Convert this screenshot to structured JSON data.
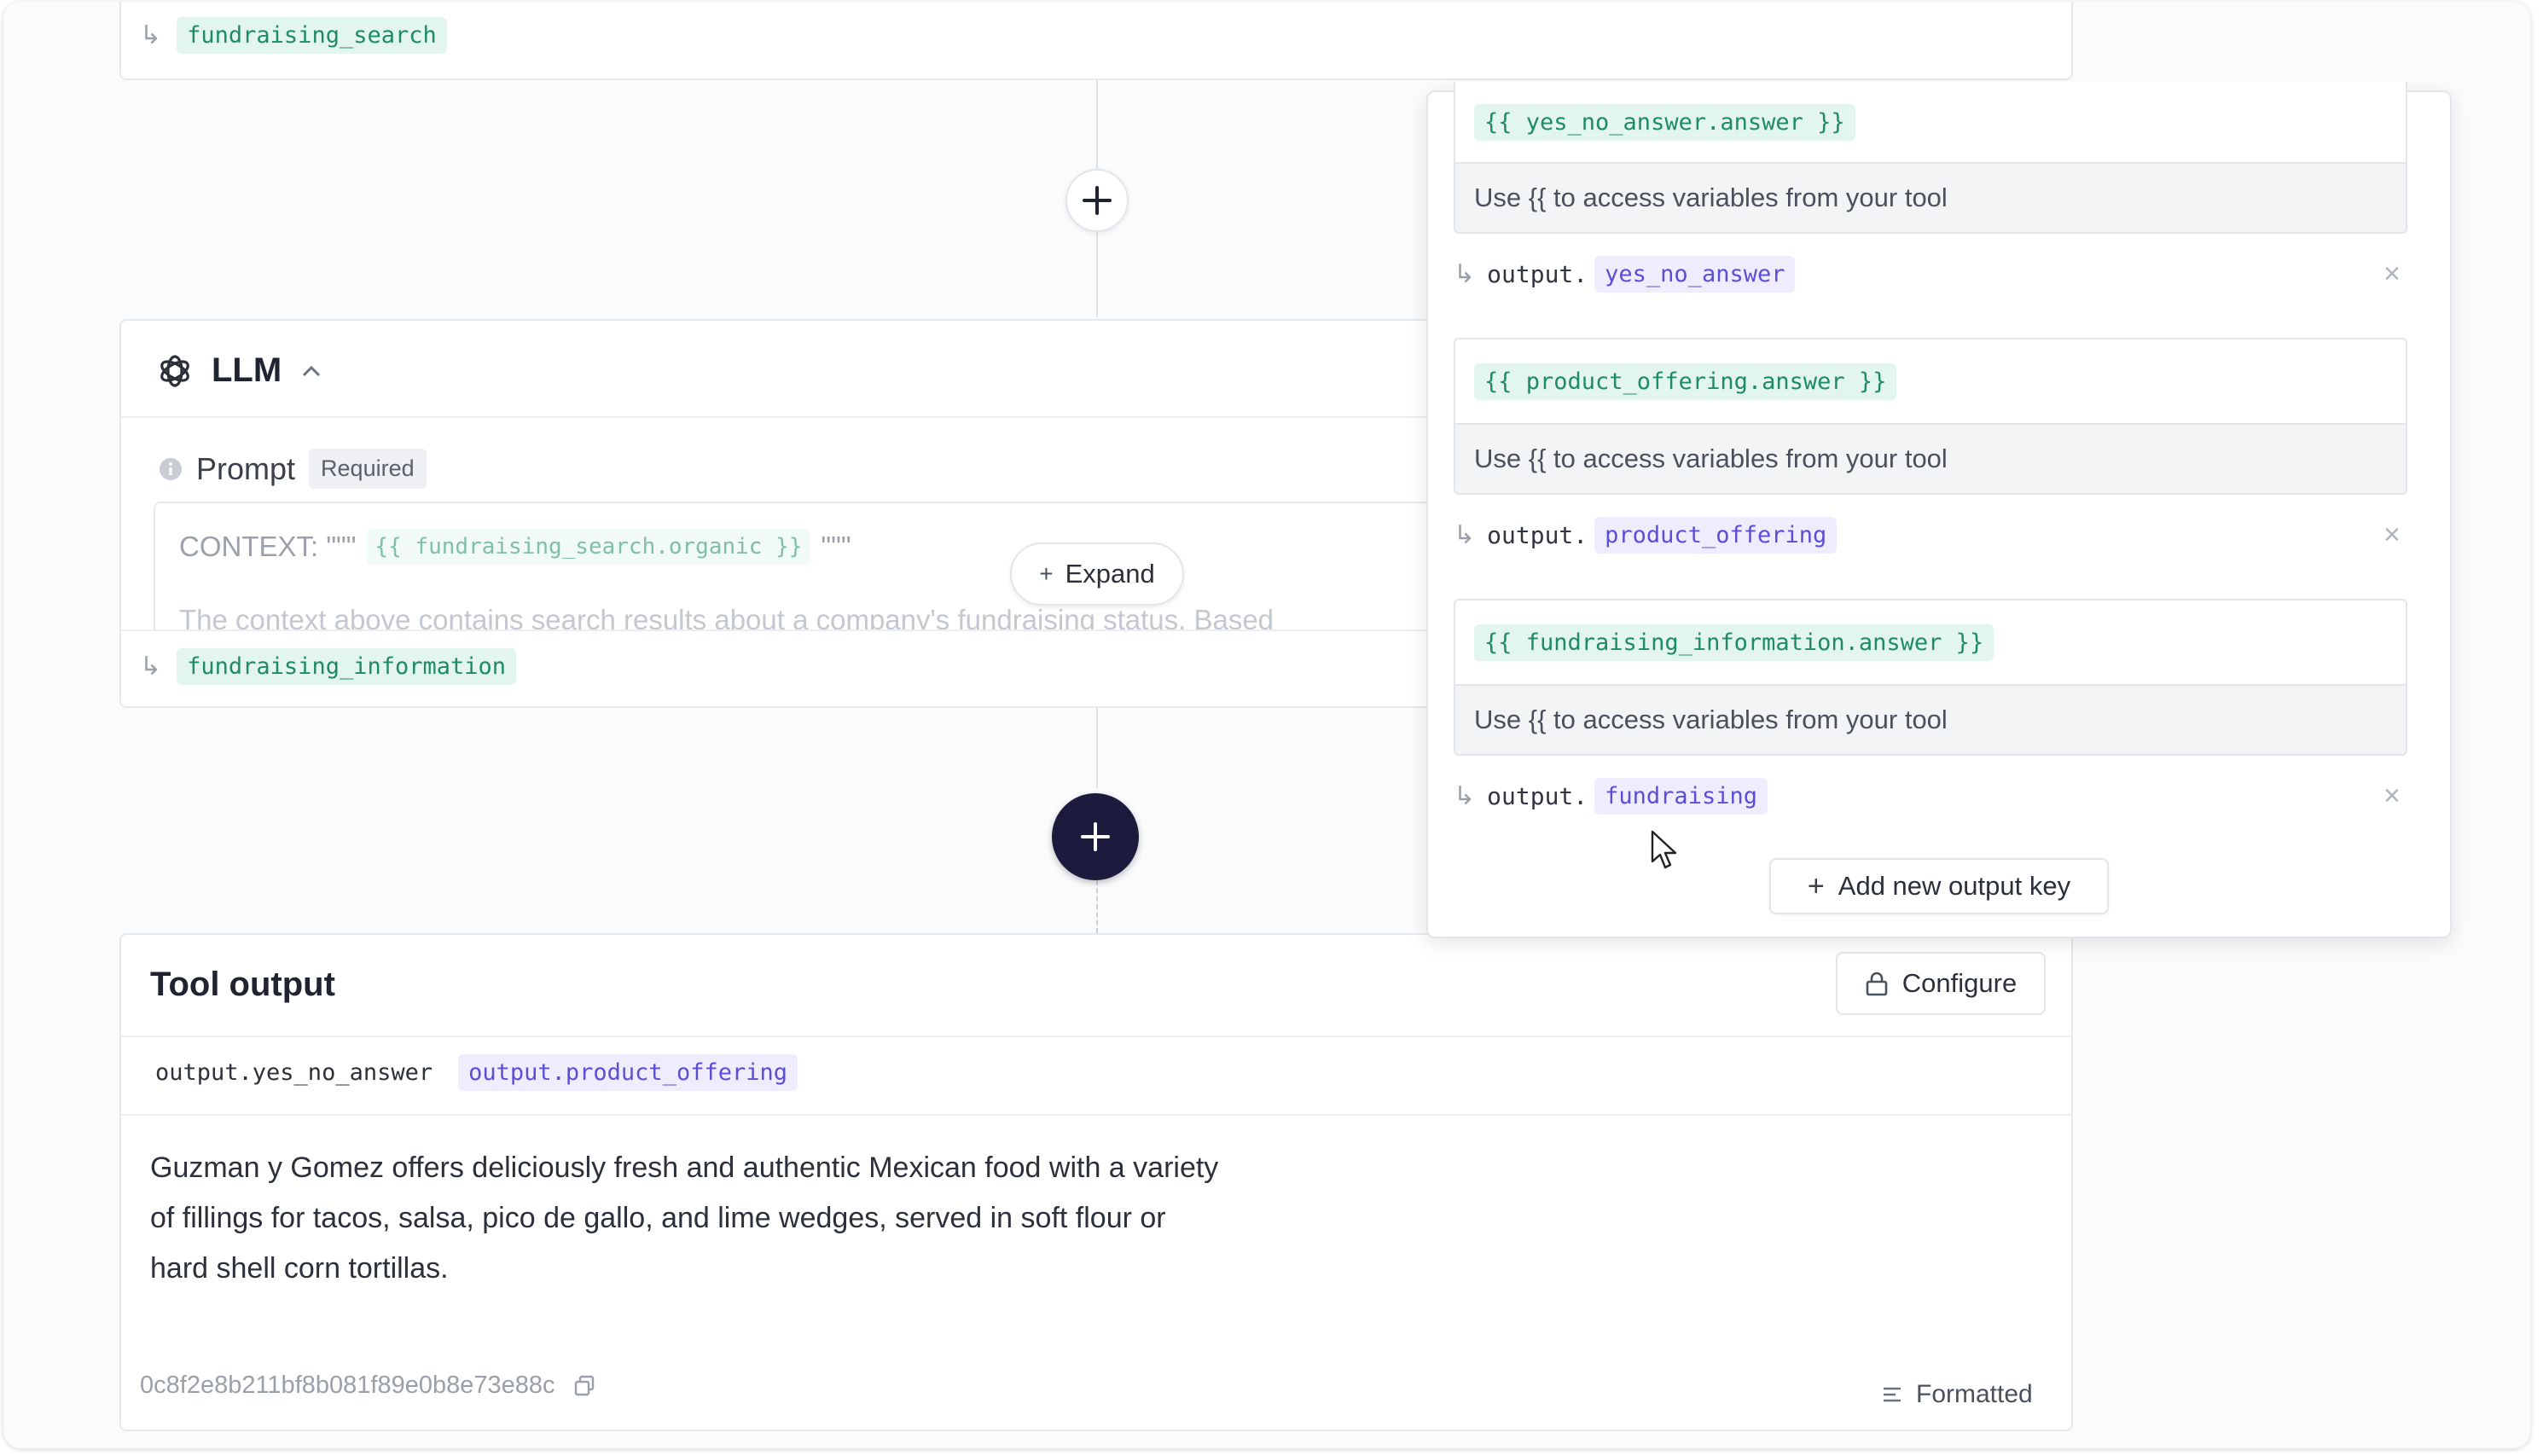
{
  "top_node": {
    "output_var": "fundraising_search"
  },
  "llm": {
    "title": "LLM",
    "prompt_label": "Prompt",
    "required_badge": "Required",
    "context_prefix": "CONTEXT: \"\"\"",
    "context_var": "{{ fundraising_search.organic }}",
    "context_suffix": "\"\"\"",
    "faded_text": "The context above contains search results about a company's fundraising status. Based",
    "expand_label": "Expand",
    "output_var": "fundraising_information"
  },
  "tool_output": {
    "title": "Tool output",
    "configure_label": "Configure",
    "tabs": [
      {
        "label": "output.yes_no_answer"
      },
      {
        "label": "output.product_offering"
      }
    ],
    "body_text": "Guzman y Gomez offers deliciously fresh and authentic Mexican food with a variety of fillings for tacos, salsa, pico de gallo, and lime wedges, served in soft flour or hard shell corn tortillas.",
    "hash": "0c8f2e8b211bf8b081f89e0b8e73e88c",
    "formatted_label": "Formatted"
  },
  "config_panel": {
    "output_prefix": "output.",
    "hint": "Use {{ to access variables from your tool",
    "entries": [
      {
        "template": "{{ yes_no_answer.answer }}",
        "key": "yes_no_answer"
      },
      {
        "template": "{{ product_offering.answer }}",
        "key": "product_offering"
      },
      {
        "template": "{{ fundraising_information.answer }}",
        "key": "fundraising"
      }
    ],
    "add_key_label": "Add new output key"
  },
  "colors": {
    "accent_dark": "#1c1b3d",
    "green_chip": "#e3f5ef",
    "purple_chip": "#efedfd"
  }
}
